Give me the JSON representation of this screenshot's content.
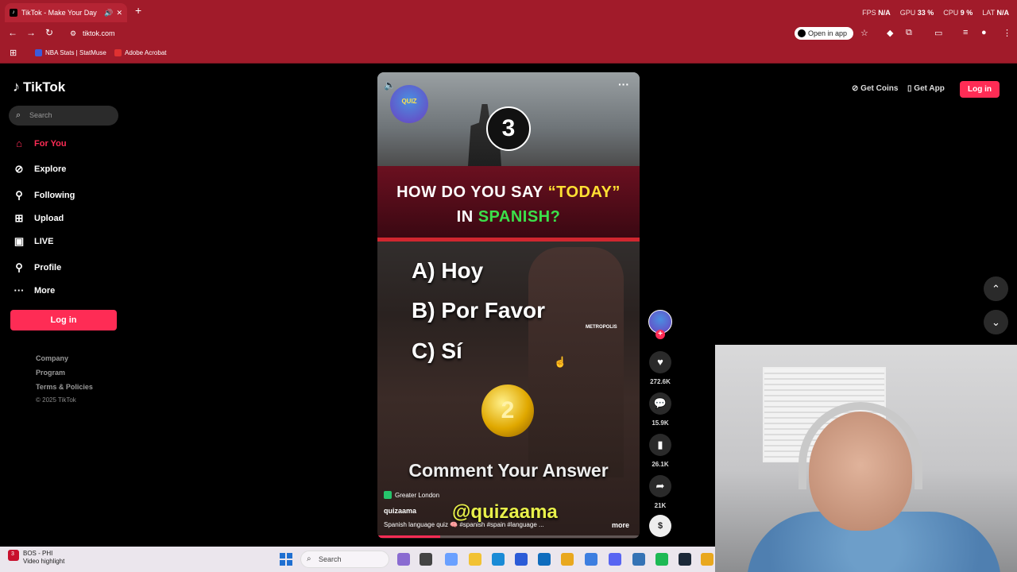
{
  "browser": {
    "tab_title": "TikTok - Make Your Day",
    "url": "tiktok.com",
    "open_in_app": "Open in app",
    "perf": {
      "fps_label": "FPS",
      "fps_value": "N/A",
      "gpu_label": "GPU",
      "gpu_value": "33 %",
      "cpu_label": "CPU",
      "cpu_value": "9 %",
      "lat_label": "LAT",
      "lat_value": "N/A"
    },
    "bookmarks": [
      "NBA Stats | StatMuse",
      "Adobe Acrobat"
    ]
  },
  "sidebar": {
    "logo": "TikTok",
    "search_placeholder": "Search",
    "nav": [
      {
        "label": "For You",
        "icon": "home-icon",
        "active": true
      },
      {
        "label": "Explore",
        "icon": "compass-icon"
      },
      {
        "label": "Following",
        "icon": "person-icon"
      },
      {
        "label": "Upload",
        "icon": "plus-box-icon"
      },
      {
        "label": "LIVE",
        "icon": "live-icon"
      },
      {
        "label": "Profile",
        "icon": "person-icon"
      },
      {
        "label": "More",
        "icon": "ellipsis-icon"
      }
    ],
    "login": "Log in",
    "footer": [
      "Company",
      "Program",
      "Terms & Policies"
    ],
    "copyright": "© 2025 TikTok"
  },
  "topright": {
    "get_coins": "Get Coins",
    "get_app": "Get App",
    "login": "Log in"
  },
  "video": {
    "logo_text": "QUIZ",
    "countdown": "3",
    "question_line1_a": "HOW DO YOU SAY ",
    "question_line1_b": "“TODAY”",
    "question_line2_a": "IN ",
    "question_line2_b": "SPANISH?",
    "options": [
      "A) Hoy",
      "B) Por Favor",
      "C) Sí"
    ],
    "sign": "METROPOLIS",
    "coin": "2",
    "cta": "Comment Your Answer",
    "watermark": "@quizaama",
    "location": "Greater London",
    "author": "quizaama",
    "caption": "Spanish language quiz 🧠 #spanish #spain #language ...",
    "more": "more",
    "progress": 0.24
  },
  "actions": {
    "likes": "272.6K",
    "comments": "15.9K",
    "saves": "26.1K",
    "shares": "21K"
  },
  "taskbar": {
    "notif_title": "BOS - PHI",
    "notif_sub": "Video highlight",
    "notif_badge": "3",
    "search": "Search"
  },
  "colors": {
    "accent": "#fe2c55",
    "chrome": "#a11b2a",
    "quiz_yellow": "#ffe033",
    "quiz_green": "#3be04a"
  }
}
